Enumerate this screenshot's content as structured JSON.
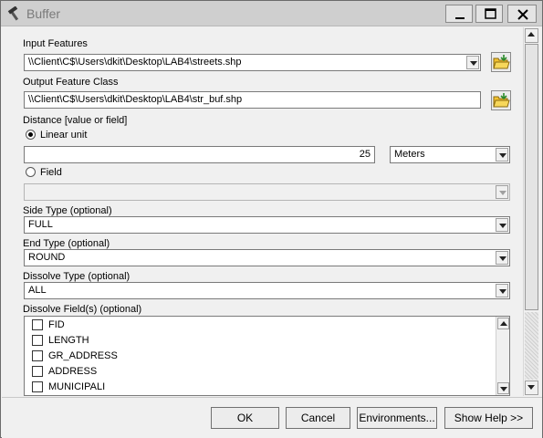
{
  "window": {
    "title": "Buffer",
    "icon": "hammer-icon"
  },
  "form": {
    "input_features": {
      "label": "Input Features",
      "value": "\\\\Client\\C$\\Users\\dkit\\Desktop\\LAB4\\streets.shp"
    },
    "output_feature_class": {
      "label": "Output Feature Class",
      "value": "\\\\Client\\C$\\Users\\dkit\\Desktop\\LAB4\\str_buf.shp"
    },
    "distance": {
      "label": "Distance [value or field]",
      "linear_unit_label": "Linear unit",
      "linear_unit_selected": true,
      "value": "25",
      "unit": "Meters",
      "field_label": "Field",
      "field_value": ""
    },
    "side_type": {
      "label": "Side Type (optional)",
      "value": "FULL"
    },
    "end_type": {
      "label": "End Type (optional)",
      "value": "ROUND"
    },
    "dissolve_type": {
      "label": "Dissolve Type (optional)",
      "value": "ALL"
    },
    "dissolve_fields": {
      "label": "Dissolve Field(s) (optional)",
      "items": [
        {
          "label": "FID",
          "checked": false
        },
        {
          "label": "LENGTH",
          "checked": false
        },
        {
          "label": "GR_ADDRESS",
          "checked": false
        },
        {
          "label": "ADDRESS",
          "checked": false
        },
        {
          "label": "MUNICIPALI",
          "checked": false
        }
      ]
    }
  },
  "buttons": {
    "ok": "OK",
    "cancel": "Cancel",
    "environments": "Environments...",
    "show_help": "Show Help >>"
  },
  "colors": {
    "title_bar": "#cfcfcf",
    "folder_yellow": "#f2c230"
  }
}
